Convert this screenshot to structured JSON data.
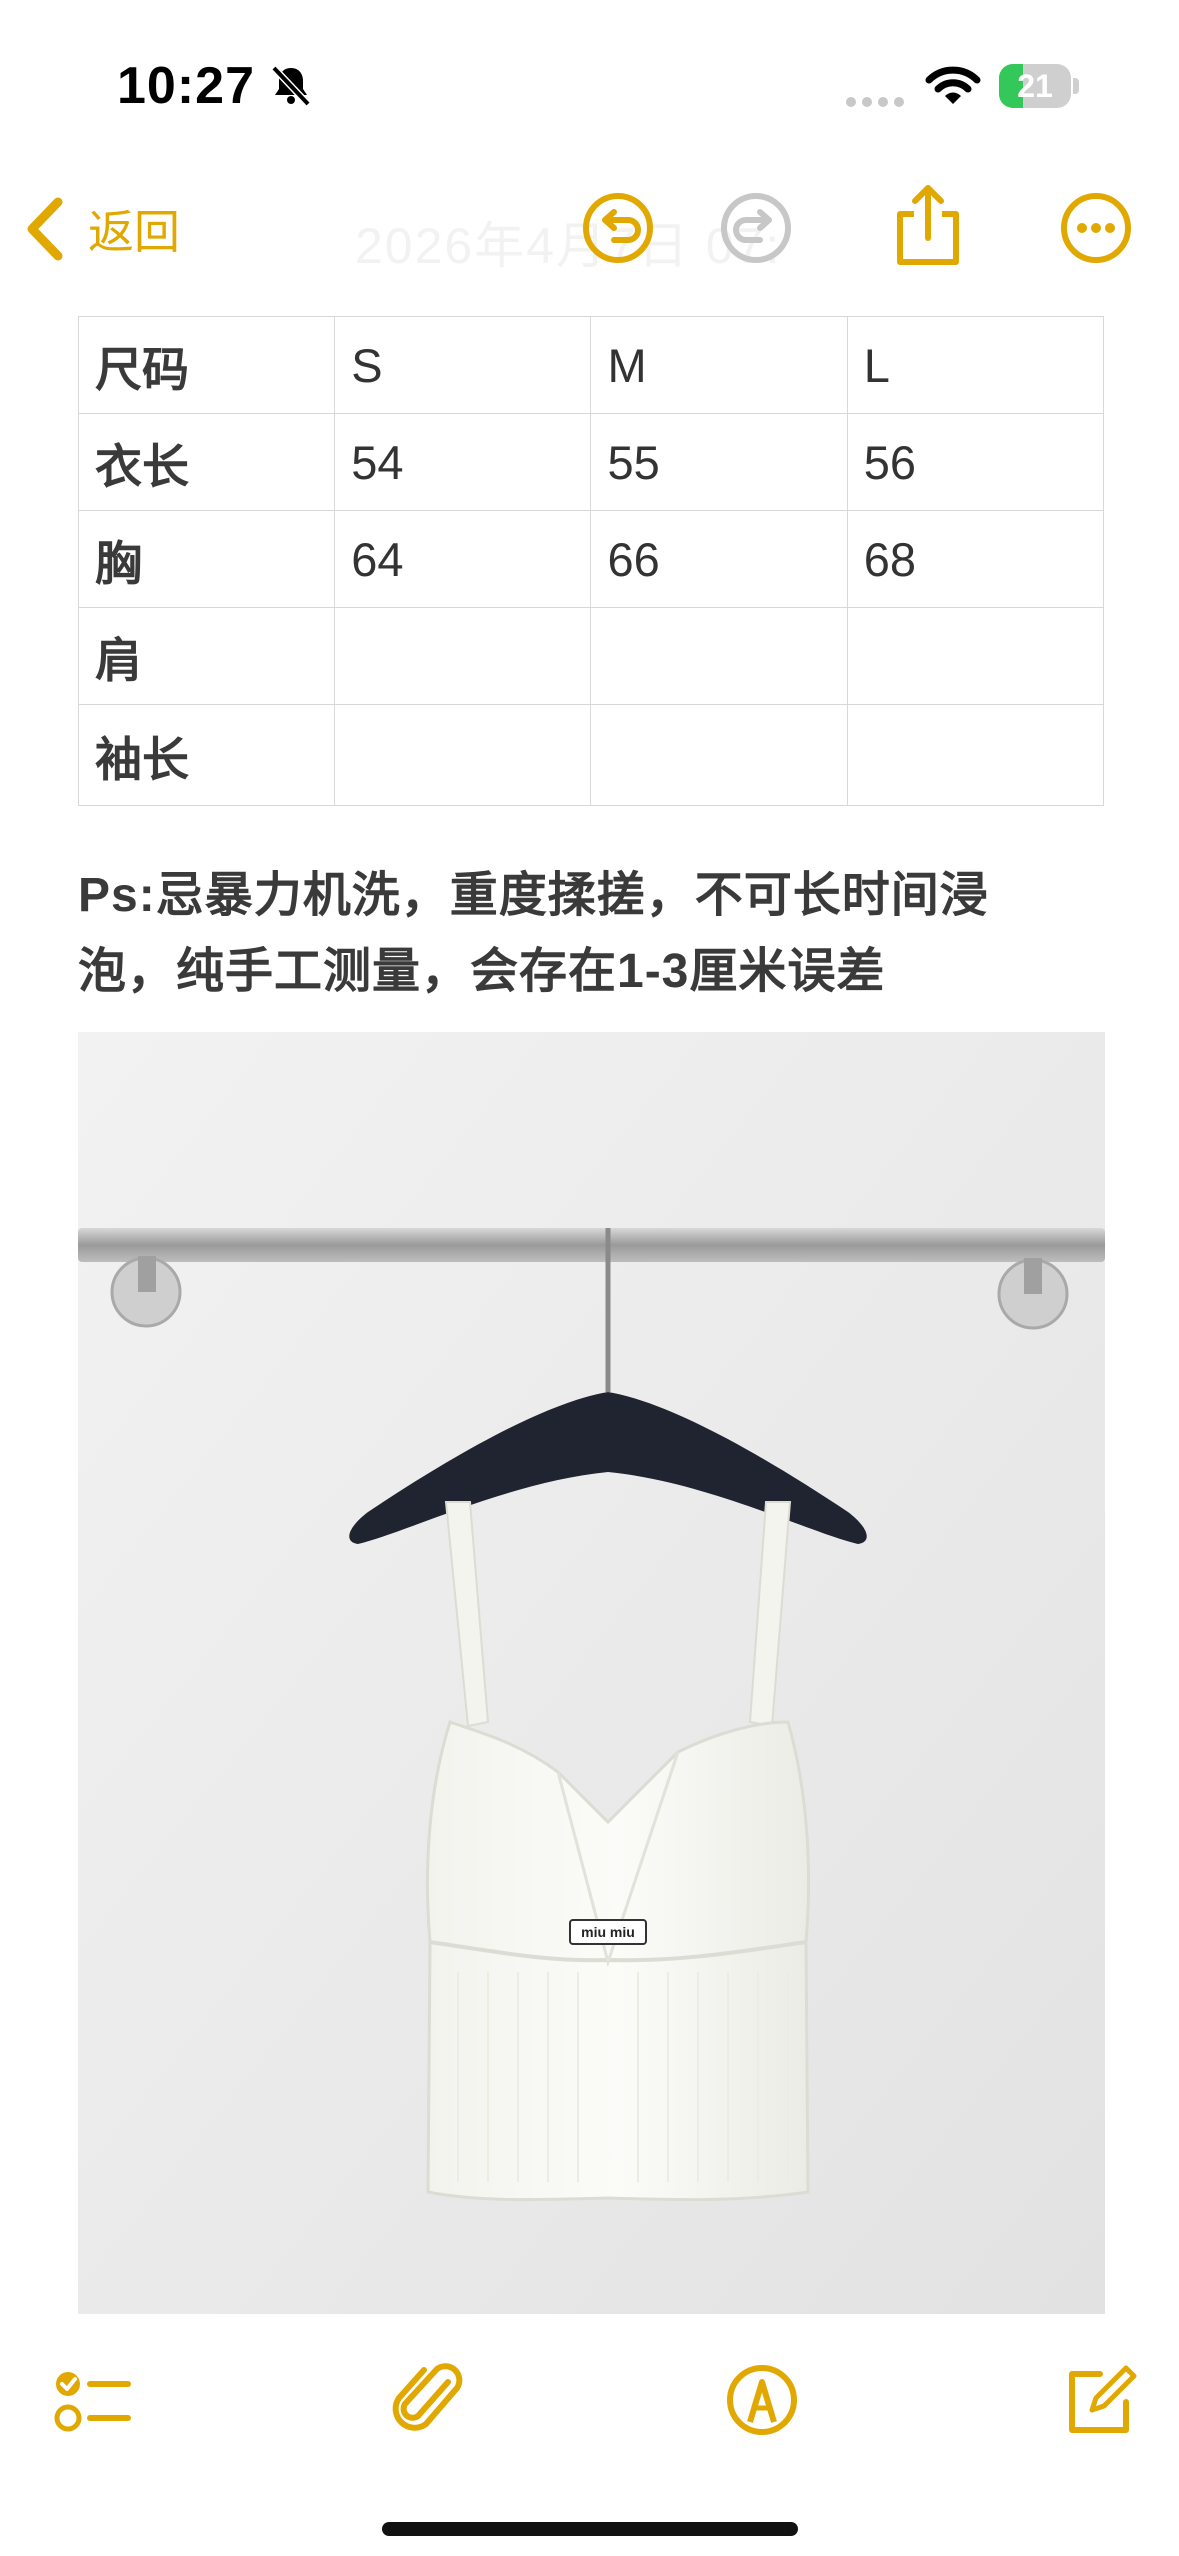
{
  "status_bar": {
    "time": "10:27",
    "battery": "21"
  },
  "nav": {
    "back_label": "返回",
    "ghost_title": "2026年4月7日 07:",
    "icons": [
      "undo-icon",
      "redo-icon",
      "share-icon",
      "more-icon"
    ]
  },
  "size_table": {
    "headers": [
      "尺码",
      "S",
      "M",
      "L"
    ],
    "rows": [
      [
        "衣长",
        "54",
        "55",
        "56"
      ],
      [
        "胸",
        "64",
        "66",
        "68"
      ],
      [
        "肩",
        "",
        "",
        ""
      ],
      [
        "袖长",
        "",
        "",
        ""
      ]
    ]
  },
  "note": {
    "line1": "Ps:忌暴力机洗，重度揉搓，不可长时间浸",
    "line2": "泡，纯手工测量，会存在1-3厘米误差"
  },
  "photo": {
    "label_text": "miu miu"
  },
  "toolbar": {
    "icons": [
      "checklist-icon",
      "attachment-icon",
      "markup-icon",
      "compose-icon"
    ]
  },
  "colors": {
    "accent": "#e0a800",
    "disabled": "#c7c7c7"
  }
}
